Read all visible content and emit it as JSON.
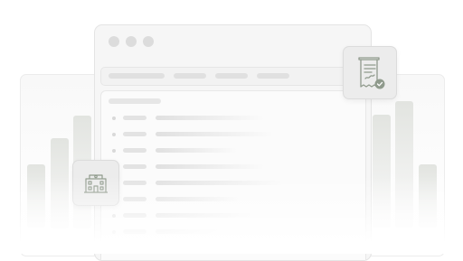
{
  "illustration": {
    "window": {
      "dots": 3,
      "toolbar_pills": 4,
      "rows": 8
    },
    "cards": [
      {
        "icon": "receipt-check-icon"
      },
      {
        "icon": "building-icon"
      }
    ],
    "colors": {
      "window": "#f6f6f6",
      "card": "#ececec",
      "icon_stroke": "#8f9a8c",
      "check": "#8f9a8c"
    }
  }
}
